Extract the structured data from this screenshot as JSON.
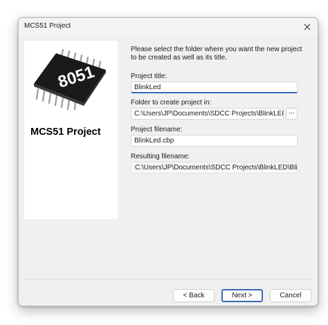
{
  "window": {
    "title": "MCS51 Project",
    "close_glyph": "close-icon"
  },
  "left_panel": {
    "chip_label": "8051",
    "heading": "MCS51 Project"
  },
  "instructions": "Please select the folder where you want the new project to be created as well as its title.",
  "fields": {
    "project_title": {
      "label": "Project title:",
      "value": "BlinkLed"
    },
    "folder": {
      "label": "Folder to create project in:",
      "value": "C:\\Users\\JP\\Documents\\SDCC Projects\\BlinkLED\\",
      "browse_label": "..."
    },
    "filename": {
      "label": "Project filename:",
      "value": "BlinkLed.cbp"
    },
    "resulting": {
      "label": "Resulting filename:",
      "value": "C:\\Users\\JP\\Documents\\SDCC Projects\\BlinkLED\\Blin"
    }
  },
  "buttons": {
    "back": "< Back",
    "next": "Next >",
    "cancel": "Cancel"
  },
  "colors": {
    "focus_accent": "#3768b7",
    "dialog_bg": "#f0f0f0"
  }
}
